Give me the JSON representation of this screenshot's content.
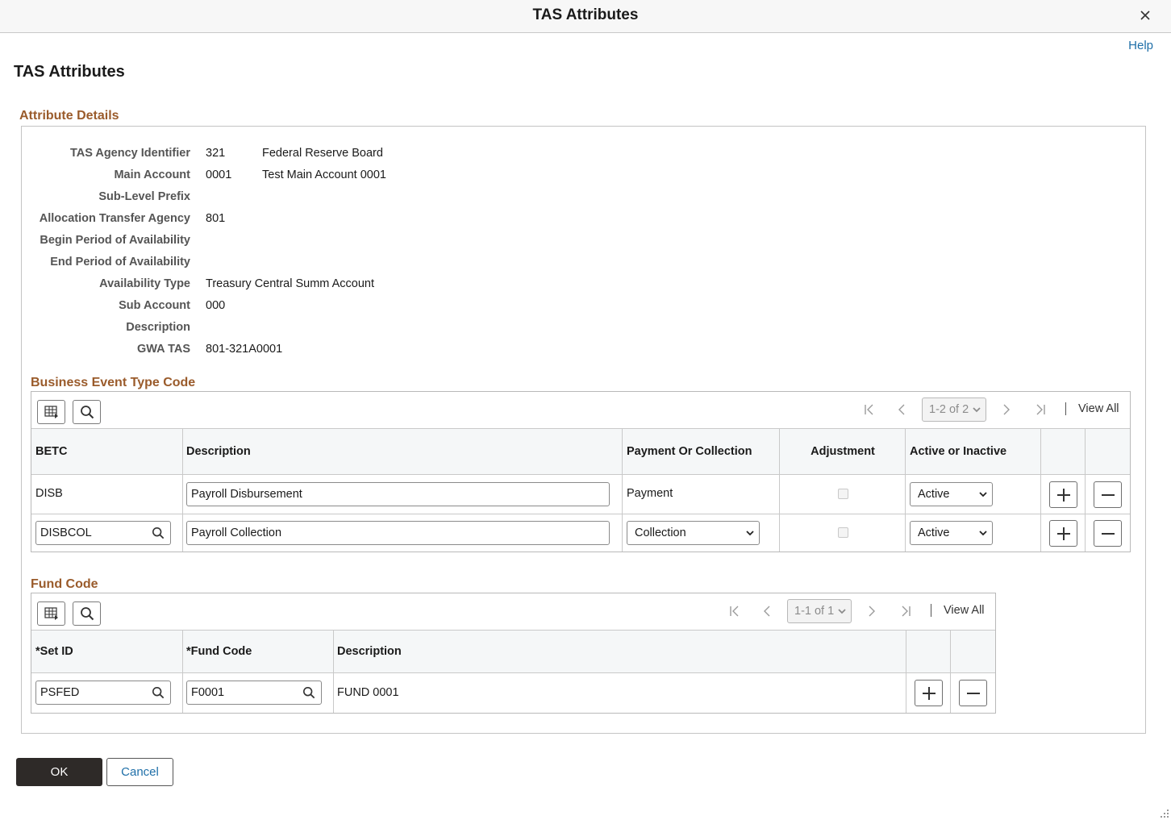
{
  "dialog": {
    "title": "TAS Attributes",
    "help_label": "Help"
  },
  "page_title": "TAS Attributes",
  "attribute_details": {
    "section_title": "Attribute Details",
    "fields": [
      {
        "label": "TAS Agency Identifier",
        "value": "321",
        "value2": "Federal Reserve Board"
      },
      {
        "label": "Main Account",
        "value": "0001",
        "value2": "Test Main Account 0001"
      },
      {
        "label": "Sub-Level Prefix",
        "value": "",
        "value2": ""
      },
      {
        "label": "Allocation Transfer Agency",
        "value": "801",
        "value2": ""
      },
      {
        "label": "Begin Period of Availability",
        "value": "",
        "value2": ""
      },
      {
        "label": "End Period of Availability",
        "value": "",
        "value2": ""
      },
      {
        "label": "Availability Type",
        "value": "Treasury Central Summ Account",
        "value2": ""
      },
      {
        "label": "Sub Account",
        "value": "000",
        "value2": ""
      },
      {
        "label": "Description",
        "value": "",
        "value2": ""
      },
      {
        "label": "GWA TAS",
        "value": "801-321A0001",
        "value2": ""
      }
    ]
  },
  "betc_grid": {
    "section_title": "Business Event Type Code",
    "pager": {
      "range": "1-2 of 2",
      "view_all": "View All"
    },
    "columns": [
      "BETC",
      "Description",
      "Payment Or Collection",
      "Adjustment",
      "Active or Inactive"
    ],
    "rows": [
      {
        "betc": "DISB",
        "description": "Payroll Disbursement",
        "payment_or_collection": "Payment",
        "adjustment": false,
        "status": "Active"
      },
      {
        "betc": "DISBCOL",
        "description": "Payroll Collection",
        "payment_or_collection": "Collection",
        "adjustment": false,
        "status": "Active"
      }
    ]
  },
  "fund_grid": {
    "section_title": "Fund Code",
    "pager": {
      "range": "1-1 of 1",
      "view_all": "View All"
    },
    "columns": [
      "*Set ID",
      "*Fund Code",
      "Description"
    ],
    "rows": [
      {
        "set_id": "PSFED",
        "fund_code": "F0001",
        "description": "FUND 0001"
      }
    ]
  },
  "buttons": {
    "ok": "OK",
    "cancel": "Cancel"
  },
  "colors": {
    "section_title": "#9a5b2b",
    "link": "#1f6fa8",
    "primary_button": "#2e2a28"
  }
}
